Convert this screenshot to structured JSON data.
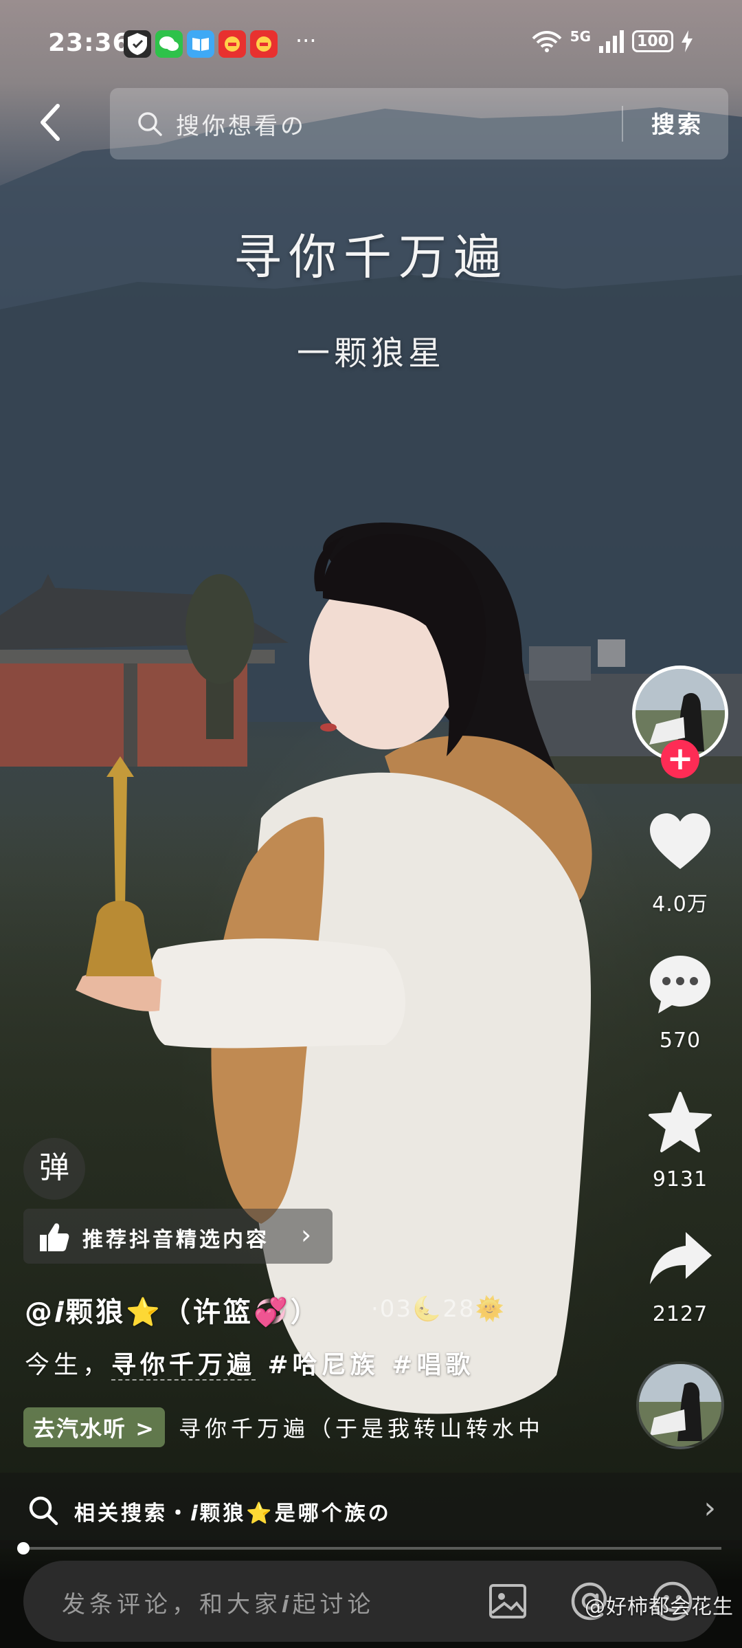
{
  "status_bar": {
    "time": "23:36",
    "battery": "100",
    "network": "5G",
    "more": "···"
  },
  "top_bar": {
    "search_placeholder": "搜你想看の",
    "search_button": "搜索"
  },
  "video_overlay": {
    "song_title": "寻你千万遍",
    "artist": "一颗狼星"
  },
  "right_rail": {
    "like_count": "4.0万",
    "comment_count": "570",
    "favorite_count": "9131",
    "share_count": "2127"
  },
  "danmaku_button": "弹",
  "recommend": {
    "label": "推荐抖音精选内容"
  },
  "post": {
    "author": "@𝒊颗狼⭐（许篮💞）",
    "date": "·03🌜28🌞",
    "desc_prefix": "今生，",
    "desc_highlight": "寻你千万遍",
    "tags": "#哈尼族 #唱歌"
  },
  "music": {
    "chip": "去汽水听 >",
    "name": "寻你千万遍（于是我转山转水中"
  },
  "related_search": {
    "label": "相关搜索・𝒊颗狼⭐是哪个族の"
  },
  "progress": {
    "fraction": 0.0
  },
  "comment_bar": {
    "placeholder": "发条评论，和大家𝒊起讨论"
  },
  "watermark": "@好柿都会花生"
}
